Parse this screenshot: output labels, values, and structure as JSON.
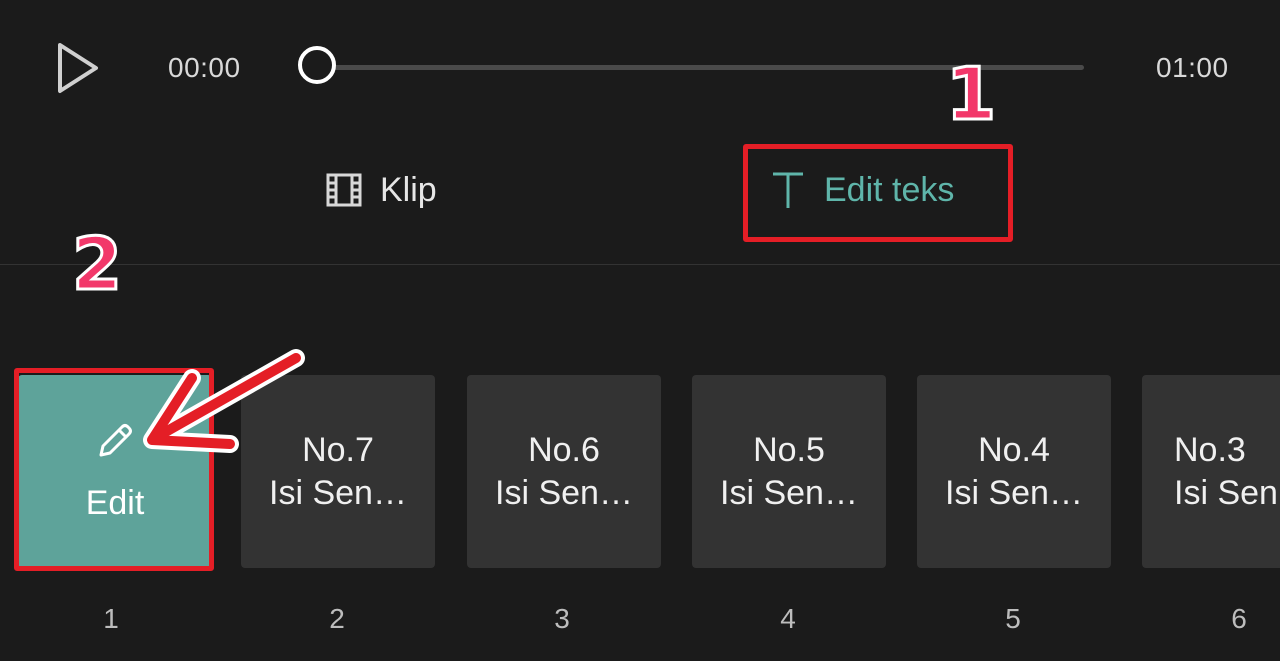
{
  "player": {
    "current_time": "00:00",
    "total_time": "01:00",
    "progress": 0
  },
  "tabs": [
    {
      "label": "Klip",
      "icon": "film-icon",
      "active": false
    },
    {
      "label": "Edit teks",
      "icon": "text-icon",
      "active": true
    }
  ],
  "annotations": {
    "step1": "1",
    "step2": "2",
    "color": "#e41e26",
    "number_color": "#f2386a"
  },
  "edit_card": {
    "label": "Edit",
    "icon": "pencil-icon",
    "index": "1",
    "color": "#5ea39a"
  },
  "cards": [
    {
      "title": "No.7",
      "subtitle": "Isi Sen…",
      "index": "2"
    },
    {
      "title": "No.6",
      "subtitle": "Isi Sen…",
      "index": "3"
    },
    {
      "title": "No.5",
      "subtitle": "Isi Sen…",
      "index": "4"
    },
    {
      "title": "No.4",
      "subtitle": "Isi Sen…",
      "index": "5"
    },
    {
      "title": "No.3",
      "subtitle": "Isi Sen",
      "index": "6"
    }
  ],
  "accent_color": "#5fb5aa"
}
